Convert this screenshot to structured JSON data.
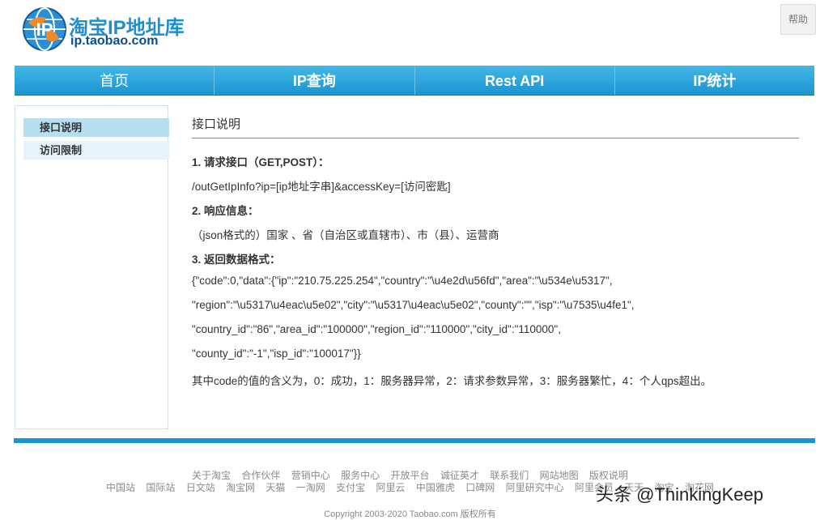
{
  "header": {
    "logo_title": "淘宝IP地址库",
    "logo_domain": "ip.taobao.com",
    "help_label": "帮助"
  },
  "nav": {
    "items": [
      "首页",
      "IP查询",
      "Rest API",
      "IP统计"
    ]
  },
  "sidebar": {
    "items": [
      "接口说明",
      "访问限制"
    ]
  },
  "main": {
    "title": "接口说明",
    "lines": [
      "1. 请求接口（GET,POST）：",
      "/outGetIpInfo?ip=[ip地址字串]&accessKey=[访问密匙]",
      "2. 响应信息：",
      "（json格式的）国家 、省（自治区或直辖市）、市（县）、运营商",
      "3. 返回数据格式：",
      "{\"code\":0,\"data\":{\"ip\":\"210.75.225.254\",\"country\":\"\\u4e2d\\u56fd\",\"area\":\"\\u534e\\u5317\",",
      "\"region\":\"\\u5317\\u4eac\\u5e02\",\"city\":\"\\u5317\\u4eac\\u5e02\",\"county\":\"\",\"isp\":\"\\u7535\\u4fe1\",",
      "\"country_id\":\"86\",\"area_id\":\"100000\",\"region_id\":\"110000\",\"city_id\":\"110000\",",
      "\"county_id\":\"-1\",\"isp_id\":\"100017\"}}",
      "其中code的值的含义为，0：成功，1：服务器异常，2：请求参数异常，3：服务器繁忙，4：个人qps超出。"
    ]
  },
  "footer": {
    "row1": [
      "关于淘宝",
      "合作伙伴",
      "营销中心",
      "服务中心",
      "开放平台",
      "诚征英才",
      "联系我们",
      "网站地图",
      "版权说明"
    ],
    "row2": [
      "中国站",
      "国际站",
      "日文站",
      "淘宝网",
      "天猫",
      "一淘网",
      "支付宝",
      "阿里云",
      "中国雅虎",
      "口碑网",
      "阿里研究中心",
      "阿里会员",
      "天天",
      "淘宝",
      "淘花网"
    ],
    "copyright": "Copyright 2003-2020 Taobao.com 版权所有",
    "watermark": "头条 @ThinkingKeep"
  },
  "colors": {
    "accent": "#1a95d2",
    "sidebar_active": "#b8def2",
    "sidebar_item": "#e6f3fa"
  }
}
